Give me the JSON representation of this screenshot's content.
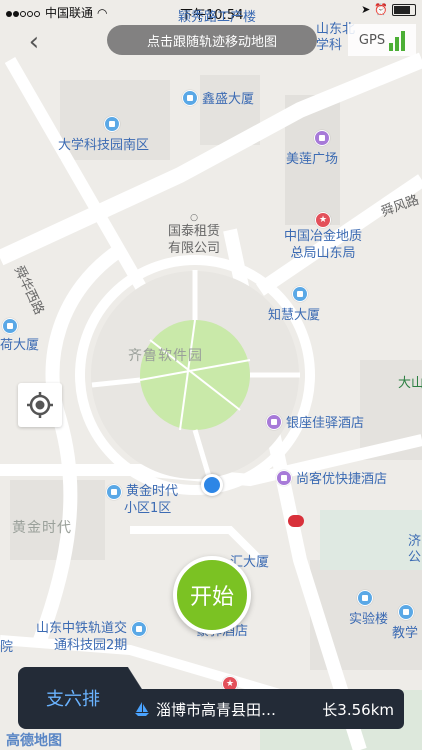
{
  "status_bar": {
    "carrier": "中国联通",
    "time": "下午10:54"
  },
  "toast": {
    "message": "点击跟随轨迹移动地图"
  },
  "gps": {
    "label": "GPS"
  },
  "map": {
    "pois": [
      {
        "id": "xinsheng",
        "label": "鑫盛大厦",
        "icon": "building-icon",
        "color": "#5aa8e6"
      },
      {
        "id": "kejiyuan",
        "label": "大学科技园南区",
        "icon": "building-icon",
        "color": "#5aa8e6"
      },
      {
        "id": "meilian",
        "label": "美莲广场",
        "icon": "shopping-icon",
        "color": "#a77ad8"
      },
      {
        "id": "zhihui",
        "label": "知慧大厦",
        "icon": "building-icon",
        "color": "#5aa8e6"
      },
      {
        "id": "yinzuo",
        "label": "银座佳驿酒店",
        "icon": "hotel-icon",
        "color": "#a77ad8"
      },
      {
        "id": "shangke",
        "label": "尚客优快捷酒店",
        "icon": "hotel-icon",
        "color": "#a77ad8"
      },
      {
        "id": "shiyanlou",
        "label": "实验楼",
        "icon": "building-icon",
        "color": "#5aa8e6"
      },
      {
        "id": "jiaoxue",
        "label": "教学",
        "icon": "building-icon",
        "color": "#5aa8e6"
      }
    ],
    "poi_blocks": {
      "guotai_line1": "国泰租赁",
      "guotai_line2": "有限公司",
      "yejin_line1": "中国冶金地质",
      "yejin_line2": "总局山东局",
      "huangjin_line1": "黄金时代",
      "huangjin_line2": "小区1区",
      "zhongtie_line1": "山东中铁轨道交",
      "zhongtie_line2": "通科技园2期"
    },
    "partial_labels": {
      "top_road": "颖秀路工产楼",
      "top_right_1": "山东北",
      "top_right_2": "学科",
      "left_building": "荷大厦",
      "right_edge": "大山",
      "right_edge_2": "济",
      "right_edge_3": "公",
      "hotel_bottom": "豪驿酒店",
      "mid_building": "汇大厦",
      "left_bottom": "院"
    },
    "area_labels": {
      "qilu": "齐鲁软件园",
      "huangjin_area": "黄金时代"
    },
    "road_labels": {
      "shunhua_west": "舜华西路",
      "shunfeng": "舜风路",
      "shunhua_short": "舜华"
    }
  },
  "start_button": {
    "label": "开始"
  },
  "route_panel": {
    "tab_label": "支六排",
    "destination": "淄博市高青县田…",
    "length": "长3.56km"
  },
  "watermark": "高德地图"
}
